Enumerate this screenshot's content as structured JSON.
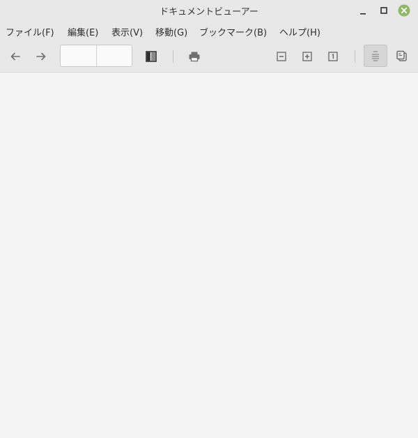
{
  "window": {
    "title": "ドキュメントビューアー"
  },
  "menubar": {
    "items": [
      {
        "label": "ファイル(F)"
      },
      {
        "label": "編集(E)"
      },
      {
        "label": "表示(V)"
      },
      {
        "label": "移動(G)"
      },
      {
        "label": "ブックマーク(B)"
      },
      {
        "label": "ヘルプ(H)"
      }
    ]
  },
  "toolbar": {
    "page_current": "",
    "page_total": "",
    "icons": {
      "back": "arrow-left-icon",
      "forward": "arrow-right-icon",
      "sidebar": "sidebar-toggle-icon",
      "print": "printer-icon",
      "zoom_out": "zoom-out-icon",
      "zoom_in": "zoom-in-icon",
      "zoom_original": "zoom-original-icon",
      "continuous": "continuous-view-icon",
      "dual": "dual-page-icon"
    }
  },
  "colors": {
    "close_button": "#8fb96a",
    "chrome": "#e8e8e8",
    "content": "#f4f4f4"
  }
}
